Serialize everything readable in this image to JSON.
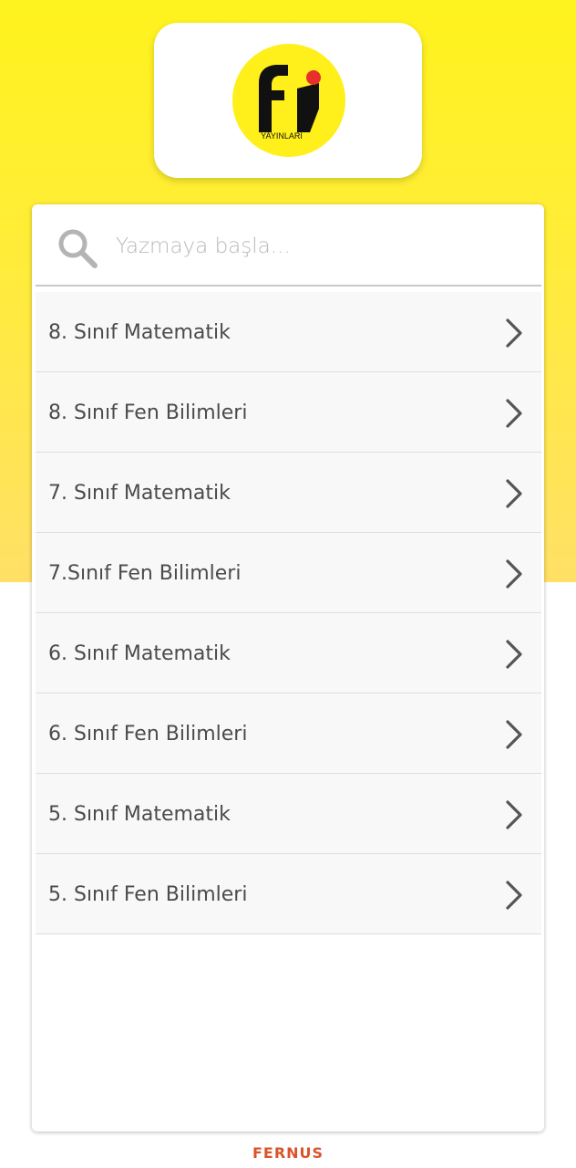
{
  "colors": {
    "background_top": "#fff31d",
    "logo_yellow": "#ffef1a",
    "logo_accent": "#e8302a",
    "footer_text": "#d9542b"
  },
  "logo": {
    "icon": "fi-yayinlari-logo",
    "brand_text": "YAYINLARI"
  },
  "search": {
    "icon": "search-icon",
    "placeholder": "Yazmaya başla..."
  },
  "list": {
    "items": [
      {
        "label": "8. Sınıf Matematik",
        "icon": "chevron-right-icon"
      },
      {
        "label": "8. Sınıf Fen Bilimleri",
        "icon": "chevron-right-icon"
      },
      {
        "label": "7. Sınıf Matematik",
        "icon": "chevron-right-icon"
      },
      {
        "label": "7.Sınıf Fen Bilimleri",
        "icon": "chevron-right-icon"
      },
      {
        "label": "6. Sınıf Matematik",
        "icon": "chevron-right-icon"
      },
      {
        "label": "6. Sınıf Fen Bilimleri",
        "icon": "chevron-right-icon"
      },
      {
        "label": "5. Sınıf Matematik",
        "icon": "chevron-right-icon"
      },
      {
        "label": "5. Sınıf Fen Bilimleri",
        "icon": "chevron-right-icon"
      }
    ]
  },
  "footer": {
    "brand": "FERNUS"
  }
}
